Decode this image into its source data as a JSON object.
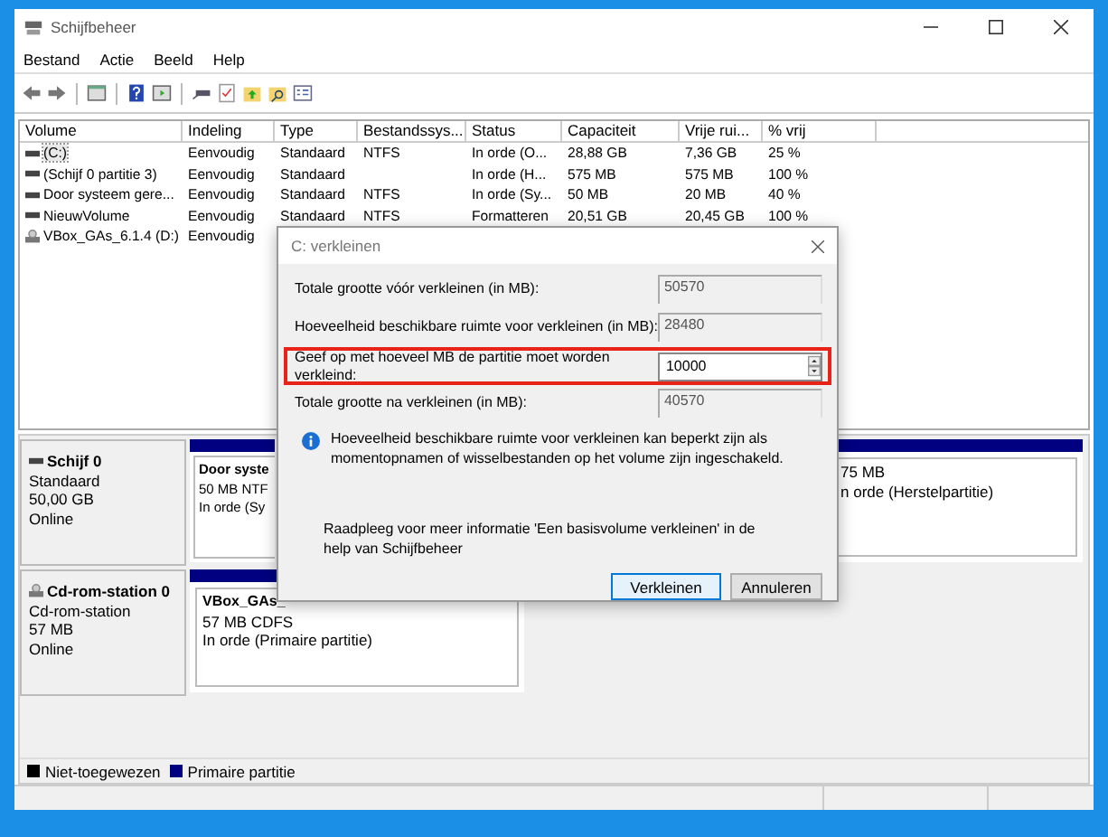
{
  "window": {
    "title": "Schijfbeheer"
  },
  "menu": [
    "Bestand",
    "Actie",
    "Beeld",
    "Help"
  ],
  "volumes": {
    "columns": [
      "Volume",
      "Indeling",
      "Type",
      "Bestandssys...",
      "Status",
      "Capaciteit",
      "Vrije rui...",
      "% vrij"
    ],
    "rows": [
      {
        "kind": "drive",
        "selected": true,
        "cells": [
          "(C:)",
          "Eenvoudig",
          "Standaard",
          "NTFS",
          "In orde (O...",
          "28,88 GB",
          "7,36 GB",
          "25 %"
        ]
      },
      {
        "kind": "drive",
        "selected": false,
        "cells": [
          "(Schijf 0 partitie 3)",
          "Eenvoudig",
          "Standaard",
          "",
          "In orde (H...",
          "575 MB",
          "575 MB",
          "100 %"
        ]
      },
      {
        "kind": "drive",
        "selected": false,
        "cells": [
          "Door systeem gere...",
          "Eenvoudig",
          "Standaard",
          "NTFS",
          "In orde (Sy...",
          "50 MB",
          "20 MB",
          "40 %"
        ]
      },
      {
        "kind": "drive",
        "selected": false,
        "cells": [
          "NieuwVolume",
          "Eenvoudig",
          "Standaard",
          "NTFS",
          "Formatteren",
          "20,51 GB",
          "20,45 GB",
          "100 %"
        ]
      },
      {
        "kind": "cd",
        "selected": false,
        "cells": [
          "VBox_GAs_6.1.4 (D:)",
          "Eenvoudig"
        ]
      }
    ]
  },
  "disks": [
    {
      "kind": "drive",
      "name": "Schijf 0",
      "lines": [
        "Standaard",
        "50,00 GB",
        "Online"
      ],
      "partitions": [
        {
          "kind": "left",
          "title": "Door syste",
          "lines": [
            "50 MB NTF",
            "In orde (Sy"
          ]
        },
        {
          "kind": "right",
          "lines": [
            "75 MB",
            "n orde (Herstelpartitie)"
          ]
        }
      ]
    },
    {
      "kind": "cd",
      "name": "Cd-rom-station 0",
      "lines": [
        "Cd-rom-station",
        "57 MB",
        "Online"
      ],
      "partitions": [
        {
          "kind": "wide",
          "title": "VBox_GAs_",
          "lines": [
            "57 MB CDFS",
            "In orde (Primaire partitie)"
          ]
        }
      ]
    }
  ],
  "legend": [
    {
      "label": "Niet-toegewezen",
      "color": "#000000"
    },
    {
      "label": "Primaire partitie",
      "color": "#000080"
    }
  ],
  "dialog": {
    "title": "C: verkleinen",
    "fields": [
      {
        "kind": "readonly",
        "label": "Totale grootte vóór verkleinen (in MB):",
        "value": "50570",
        "highlighted": false
      },
      {
        "kind": "readonly",
        "label": "Hoeveelheid beschikbare ruimte voor verkleinen (in MB):",
        "value": "28480",
        "highlighted": false
      },
      {
        "kind": "spin",
        "label": "Geef op met hoeveel MB de partitie moet worden verkleind:",
        "value": "10000",
        "highlighted": true
      },
      {
        "kind": "readonly",
        "label": "Totale grootte na verkleinen (in MB):",
        "value": "40570",
        "highlighted": false
      }
    ],
    "info": "Hoeveelheid beschikbare ruimte voor verkleinen kan beperkt zijn als momentopnamen of wisselbestanden op het volume zijn ingeschakeld.",
    "help": "Raadpleeg voor meer informatie 'Een basisvolume verkleinen' in de help van Schijfbeheer",
    "buttons": [
      {
        "label": "Verkleinen",
        "default": true
      },
      {
        "label": "Annuleren",
        "default": false
      }
    ]
  }
}
